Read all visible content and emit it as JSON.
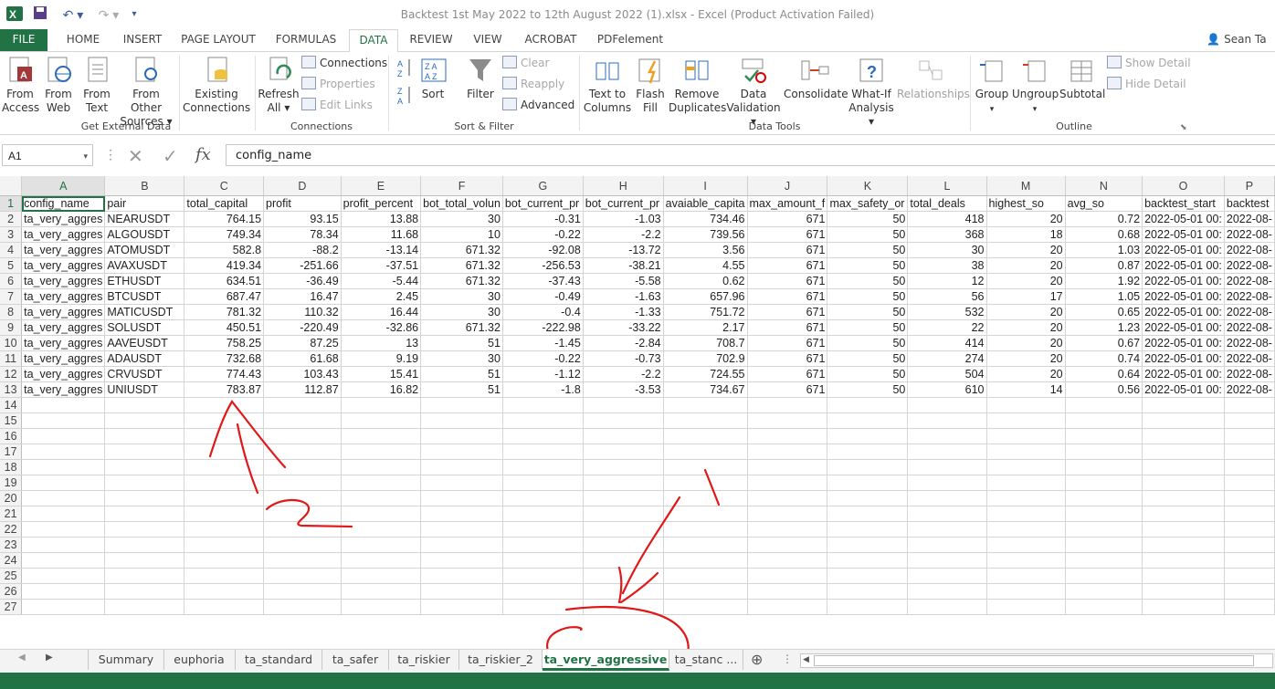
{
  "window": {
    "title": "Backtest 1st May 2022 to 12th August 2022 (1).xlsx - Excel (Product Activation Failed)",
    "user": "Sean Ta",
    "app_icon": "excel-icon"
  },
  "ribbon_tabs": [
    {
      "label": "FILE"
    },
    {
      "label": "HOME"
    },
    {
      "label": "INSERT"
    },
    {
      "label": "PAGE LAYOUT"
    },
    {
      "label": "FORMULAS"
    },
    {
      "label": "DATA"
    },
    {
      "label": "REVIEW"
    },
    {
      "label": "VIEW"
    },
    {
      "label": "ACROBAT"
    },
    {
      "label": "PDFelement"
    }
  ],
  "active_ribbon_tab": "DATA",
  "ribbon": {
    "get_external": {
      "label": "Get External Data",
      "from_access": [
        "From",
        "Access"
      ],
      "from_web": [
        "From",
        "Web"
      ],
      "from_text": [
        "From",
        "Text"
      ],
      "from_other": [
        "From Other",
        "Sources ▾"
      ],
      "existing": [
        "Existing",
        "Connections"
      ]
    },
    "connections": {
      "label": "Connections",
      "refresh": [
        "Refresh",
        "All ▾"
      ],
      "connections": "Connections",
      "properties": "Properties",
      "edit_links": "Edit Links"
    },
    "sort_filter": {
      "label": "Sort & Filter",
      "sort": "Sort",
      "filter": "Filter",
      "clear": "Clear",
      "reapply": "Reapply",
      "advanced": "Advanced"
    },
    "data_tools": {
      "label": "Data Tools",
      "text_to_columns": [
        "Text to",
        "Columns"
      ],
      "flash_fill": [
        "Flash",
        "Fill"
      ],
      "remove_duplicates": [
        "Remove",
        "Duplicates"
      ],
      "data_validation": [
        "Data",
        "Validation ▾"
      ],
      "consolidate": "Consolidate",
      "what_if": [
        "What-If",
        "Analysis ▾"
      ],
      "relationships": "Relationships"
    },
    "outline": {
      "label": "Outline",
      "group": "Group",
      "ungroup": "Ungroup",
      "subtotal": "Subtotal",
      "show_detail": "Show Detail",
      "hide_detail": "Hide Detail"
    }
  },
  "formula_bar": {
    "name_box": "A1",
    "formula": "config_name"
  },
  "columns": [
    "A",
    "B",
    "C",
    "D",
    "E",
    "F",
    "G",
    "H",
    "I",
    "J",
    "K",
    "L",
    "M",
    "N",
    "O",
    "P"
  ],
  "header_row": [
    "config_name",
    "pair",
    "total_capital",
    "profit",
    "profit_percent",
    "bot_total_volun",
    "bot_current_pr",
    "bot_current_pr",
    "avaiable_capita",
    "max_amount_f",
    "max_safety_or",
    "total_deals",
    "highest_so",
    "avg_so",
    "backtest_start",
    "backtest"
  ],
  "rows": [
    [
      "ta_very_aggres",
      "NEARUSDT",
      "764.15",
      "93.15",
      "13.88",
      "30",
      "-0.31",
      "-1.03",
      "734.46",
      "671",
      "50",
      "418",
      "20",
      "0.72",
      "2022-05-01 00:",
      "2022-08-"
    ],
    [
      "ta_very_aggres",
      "ALGOUSDT",
      "749.34",
      "78.34",
      "11.68",
      "10",
      "-0.22",
      "-2.2",
      "739.56",
      "671",
      "50",
      "368",
      "18",
      "0.68",
      "2022-05-01 00:",
      "2022-08-"
    ],
    [
      "ta_very_aggres",
      "ATOMUSDT",
      "582.8",
      "-88.2",
      "-13.14",
      "671.32",
      "-92.08",
      "-13.72",
      "3.56",
      "671",
      "50",
      "30",
      "20",
      "1.03",
      "2022-05-01 00:",
      "2022-08-"
    ],
    [
      "ta_very_aggres",
      "AVAXUSDT",
      "419.34",
      "-251.66",
      "-37.51",
      "671.32",
      "-256.53",
      "-38.21",
      "4.55",
      "671",
      "50",
      "38",
      "20",
      "0.87",
      "2022-05-01 00:",
      "2022-08-"
    ],
    [
      "ta_very_aggres",
      "ETHUSDT",
      "634.51",
      "-36.49",
      "-5.44",
      "671.32",
      "-37.43",
      "-5.58",
      "0.62",
      "671",
      "50",
      "12",
      "20",
      "1.92",
      "2022-05-01 00:",
      "2022-08-"
    ],
    [
      "ta_very_aggres",
      "BTCUSDT",
      "687.47",
      "16.47",
      "2.45",
      "30",
      "-0.49",
      "-1.63",
      "657.96",
      "671",
      "50",
      "56",
      "17",
      "1.05",
      "2022-05-01 00:",
      "2022-08-"
    ],
    [
      "ta_very_aggres",
      "MATICUSDT",
      "781.32",
      "110.32",
      "16.44",
      "30",
      "-0.4",
      "-1.33",
      "751.72",
      "671",
      "50",
      "532",
      "20",
      "0.65",
      "2022-05-01 00:",
      "2022-08-"
    ],
    [
      "ta_very_aggres",
      "SOLUSDT",
      "450.51",
      "-220.49",
      "-32.86",
      "671.32",
      "-222.98",
      "-33.22",
      "2.17",
      "671",
      "50",
      "22",
      "20",
      "1.23",
      "2022-05-01 00:",
      "2022-08-"
    ],
    [
      "ta_very_aggres",
      "AAVEUSDT",
      "758.25",
      "87.25",
      "13",
      "51",
      "-1.45",
      "-2.84",
      "708.7",
      "671",
      "50",
      "414",
      "20",
      "0.67",
      "2022-05-01 00:",
      "2022-08-"
    ],
    [
      "ta_very_aggres",
      "ADAUSDT",
      "732.68",
      "61.68",
      "9.19",
      "30",
      "-0.22",
      "-0.73",
      "702.9",
      "671",
      "50",
      "274",
      "20",
      "0.74",
      "2022-05-01 00:",
      "2022-08-"
    ],
    [
      "ta_very_aggres",
      "CRVUSDT",
      "774.43",
      "103.43",
      "15.41",
      "51",
      "-1.12",
      "-2.2",
      "724.55",
      "671",
      "50",
      "504",
      "20",
      "0.64",
      "2022-05-01 00:",
      "2022-08-"
    ],
    [
      "ta_very_aggres",
      "UNIUSDT",
      "783.87",
      "112.87",
      "16.82",
      "51",
      "-1.8",
      "-3.53",
      "734.67",
      "671",
      "50",
      "610",
      "14",
      "0.56",
      "2022-05-01 00:",
      "2022-08-"
    ]
  ],
  "row_numbers": [
    "1",
    "2",
    "3",
    "4",
    "5",
    "6",
    "7",
    "8",
    "9",
    "10",
    "11",
    "12",
    "13",
    "14",
    "15",
    "16",
    "17",
    "18",
    "19",
    "20",
    "21",
    "22",
    "23",
    "24",
    "25",
    "26",
    "27"
  ],
  "sheet_tabs": [
    "Summary",
    "euphoria",
    "ta_standard",
    "ta_safer",
    "ta_riskier",
    "ta_riskier_2",
    "ta_very_aggressive",
    "ta_stanc ..."
  ],
  "active_sheet": "ta_very_aggressive",
  "colors": {
    "accent": "#217346",
    "annotation": "#e01818"
  }
}
